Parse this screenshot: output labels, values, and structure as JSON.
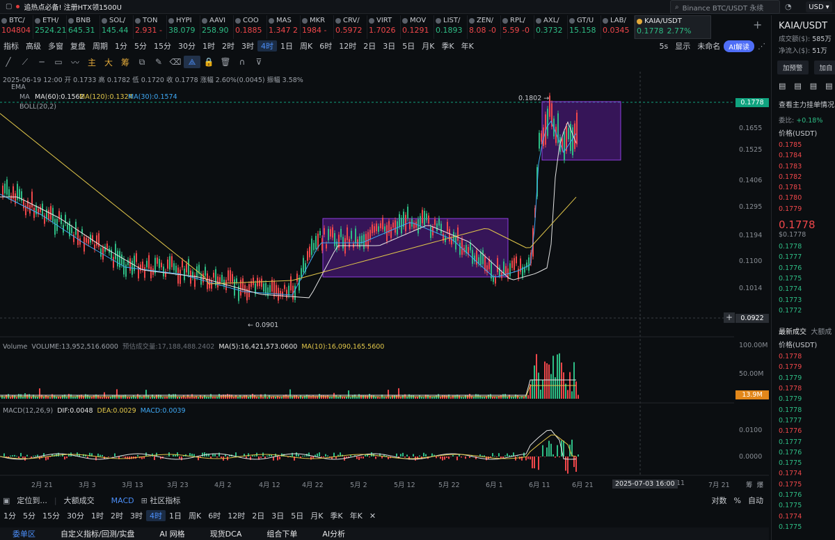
{
  "topbar": {
    "announce": "追热点必备! 注册HTX领1500U",
    "search_placeholder": "Binance BTC/USDT 永续",
    "currency": "USD"
  },
  "tickers": [
    {
      "sym": "BTC/",
      "price": "104804",
      "dir": "dn"
    },
    {
      "sym": "ETH/",
      "price": "2524.21",
      "dir": "up"
    },
    {
      "sym": "BNB",
      "price": "645.31",
      "dir": "up"
    },
    {
      "sym": "SOL/",
      "price": "145.44",
      "dir": "up"
    },
    {
      "sym": "TON",
      "price": "2.931 -",
      "dir": "dn"
    },
    {
      "sym": "HYPI",
      "price": "38.079",
      "dir": "up"
    },
    {
      "sym": "AAVI",
      "price": "258.90",
      "dir": "up"
    },
    {
      "sym": "COO",
      "price": "0.1885",
      "dir": "dn"
    },
    {
      "sym": "MAS",
      "price": "1.347 2",
      "dir": "dn"
    },
    {
      "sym": "MKR",
      "price": "1984 -",
      "dir": "dn"
    },
    {
      "sym": "CRV/",
      "price": "0.5972",
      "dir": "dn"
    },
    {
      "sym": "VIRT",
      "price": "1.7026",
      "dir": "dn"
    },
    {
      "sym": "MOV",
      "price": "0.1291",
      "dir": "dn"
    },
    {
      "sym": "LIST/",
      "price": "0.1893",
      "dir": "up"
    },
    {
      "sym": "ZEN/",
      "price": "8.08 -0",
      "dir": "dn"
    },
    {
      "sym": "RPL/",
      "price": "5.59 -0",
      "dir": "dn"
    },
    {
      "sym": "AXL/",
      "price": "0.3732",
      "dir": "up"
    },
    {
      "sym": "GT/U",
      "price": "15.158",
      "dir": "up"
    },
    {
      "sym": "LAB/",
      "price": "0.0345",
      "dir": "dn"
    }
  ],
  "active_ticker": {
    "sym": "KAIA/USDT",
    "price": "0.1778",
    "change": "2.77%"
  },
  "toolbar1": [
    "指标",
    "高级",
    "多窗",
    "复盘",
    "周期",
    "1分",
    "5分",
    "15分",
    "30分",
    "1时",
    "2时",
    "3时",
    "4时",
    "1日",
    "周K",
    "6时",
    "12时",
    "2日",
    "3日",
    "5日",
    "月K",
    "季K",
    "年K"
  ],
  "toolbar1_active": "4时",
  "toolbar1_right": [
    "5s",
    "显示",
    "未命名"
  ],
  "ai_label": "AI解读",
  "toolbar2_chars": [
    "主",
    "大",
    "筹"
  ],
  "ohlc": "2025-06-19 12:00  开 0.1733  高 0.1782  低 0.1720  收 0.1778  涨幅 2.60%(0.0045)  振幅 3.58%",
  "ema": "EMA",
  "ma_label": "MA",
  "ma60": "MA(60):0.1562",
  "ma120": "MA(120):0.1324",
  "ma30": "MA(30):0.1574",
  "boll": "BOLL(20,2)",
  "high_mark": "0.1802",
  "low_mark": "0.0901",
  "price_axis": [
    "0.1655",
    "0.1525",
    "0.1406",
    "0.1295",
    "0.1194",
    "0.1100",
    "0.1014"
  ],
  "current_price": "0.1778",
  "crosshair_price": "0.0922",
  "volume_label": "Volume",
  "volume_val": "VOLUME:13,952,516.6000",
  "volume_est": "预估成交量:17,188,488.2402",
  "vma5": "MA(5):16,421,573.0600",
  "vma10": "MA(10):16,090,165.5600",
  "vol_axis": [
    "100.00M",
    "50.00M"
  ],
  "vol_current": "13.9M",
  "macd_label": "MACD(12,26,9)",
  "dif": "DIF:0.0048",
  "dea": "DEA:0.0029",
  "macd": "MACD:0.0039",
  "macd_axis": [
    "0.0100",
    "0.0000"
  ],
  "dates": [
    "2月 21",
    "3月 3",
    "3月 13",
    "3月 23",
    "4月 2",
    "4月 12",
    "4月 22",
    "5月 2",
    "5月 12",
    "5月 22",
    "6月 1",
    "6月 11",
    "6月 21",
    "7月 21"
  ],
  "crosshair_date": "2025-07-03 16:00",
  "date_right": [
    "11",
    "筹",
    "爆"
  ],
  "bottom1": [
    "定位到...",
    "大额成交",
    "MACD",
    "社区指标"
  ],
  "bottom1_right": [
    "对数",
    "%",
    "自动"
  ],
  "bottom2": [
    "1分",
    "5分",
    "15分",
    "30分",
    "1时",
    "2时",
    "3时",
    "4时",
    "1日",
    "周K",
    "6时",
    "12时",
    "2日",
    "3日",
    "5日",
    "月K",
    "季K",
    "年K"
  ],
  "bottom2_active": "4时",
  "bottom3": [
    "委单区",
    "自定义指标/回测/实盘",
    "AI 网格",
    "现货DCA",
    "组合下单",
    "AI分析"
  ],
  "right": {
    "sym": "KAIA/USDT",
    "turnover": "成交额($):",
    "turnover_v": "585万",
    "inflow": "净流入($):",
    "inflow_v": "51万",
    "btn1": "加预警",
    "btn2": "加自",
    "main_force": "查看主力挂单情况",
    "ratio_label": "委比:",
    "ratio": "+0.18%",
    "price_hdr": "价格(USDT)",
    "asks": [
      "0.1785",
      "0.1784",
      "0.1783",
      "0.1782",
      "0.1781",
      "0.1780",
      "0.1779"
    ],
    "last": "0.1778",
    "last_usd": "$0.1778",
    "bids": [
      "0.1778",
      "0.1777",
      "0.1776",
      "0.1775",
      "0.1774",
      "0.1773",
      "0.1772"
    ],
    "trades_hdr": "最新成交",
    "trades_hdr2": "大额成",
    "trades_price_hdr": "价格(USDT)",
    "trades": [
      [
        "0.1778",
        "dn"
      ],
      [
        "0.1779",
        "dn"
      ],
      [
        "0.1779",
        "up"
      ],
      [
        "0.1778",
        "dn"
      ],
      [
        "0.1779",
        "up"
      ],
      [
        "0.1778",
        "up"
      ],
      [
        "0.1777",
        "up"
      ],
      [
        "0.1776",
        "dn"
      ],
      [
        "0.1777",
        "up"
      ],
      [
        "0.1776",
        "up"
      ],
      [
        "0.1775",
        "up"
      ],
      [
        "0.1774",
        "dn"
      ],
      [
        "0.1775",
        "dn"
      ],
      [
        "0.1776",
        "up"
      ],
      [
        "0.1775",
        "up"
      ],
      [
        "0.1774",
        "dn"
      ],
      [
        "0.1775",
        "up"
      ]
    ]
  },
  "colors": {
    "up": "#2ebd85",
    "down": "#f0474a",
    "ma30": "#3fa9f5",
    "ma60": "#e4e4e4",
    "ma120": "#e2c74a",
    "box": "#7b2cbf",
    "accent": "#4b8ef8"
  }
}
